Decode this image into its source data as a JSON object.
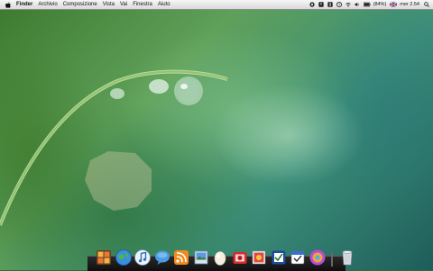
{
  "menubar": {
    "app_name": "Finder",
    "items": [
      "Archivio",
      "Composizione",
      "Vista",
      "Vai",
      "Finestra",
      "Aiuto"
    ],
    "battery": "(84%)",
    "clock": "mer 2.54"
  },
  "dock": {
    "apps": [
      "finder",
      "safari",
      "itunes",
      "ichat",
      "rss-reader",
      "preview",
      "quicklook",
      "photo-booth",
      "photos",
      "color-picker",
      "calendar",
      "itunes-store"
    ],
    "trash": "trash"
  },
  "colors": {
    "menubar_bg": "#e6e6e6",
    "dock_bg": "#1a1a1a",
    "wallpaper_primary": "#5fa05a"
  }
}
